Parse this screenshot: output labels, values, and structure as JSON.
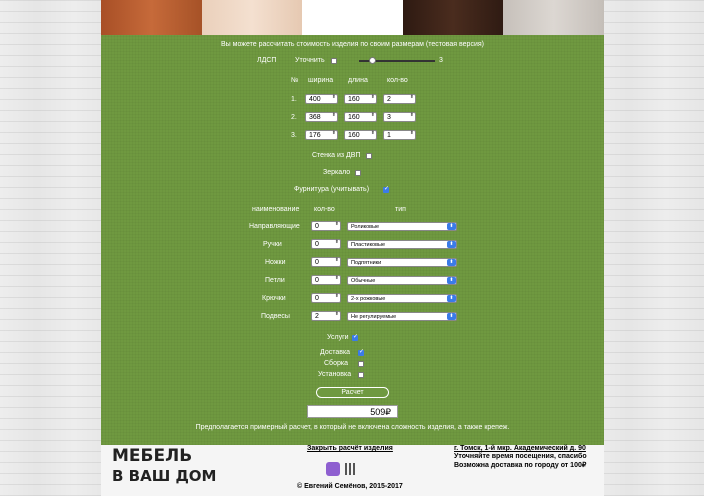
{
  "swatch_colors": [
    "#b85a2e",
    "#f0d8c4",
    "#ffffff",
    "#3b2218",
    "#cfc9c3"
  ],
  "header": {
    "title": "Вы можете рассчитать стоимость изделия по своим размерам (тестовая версия)"
  },
  "material": {
    "label": "ЛДСП",
    "refine_label": "Уточнить",
    "slider_value": "3"
  },
  "dims": {
    "col_no": "№",
    "col_width": "ширина",
    "col_length": "длина",
    "col_qty": "кол-во",
    "rows": [
      {
        "n": "1.",
        "width": "400",
        "length": "160",
        "qty": "2"
      },
      {
        "n": "2.",
        "width": "368",
        "length": "160",
        "qty": "3"
      },
      {
        "n": "3.",
        "width": "176",
        "length": "160",
        "qty": "1"
      }
    ]
  },
  "options": {
    "dvp_label": "Стенка из ДВП",
    "mirror_label": "Зеркало",
    "fittings_label": "Фурнитура (учитывать)"
  },
  "fittings": {
    "col_name": "наименование",
    "col_qty": "кол-во",
    "col_type": "тип",
    "rows": [
      {
        "name": "Направляющие",
        "qty": "0",
        "type": "Роликовые"
      },
      {
        "name": "Ручки",
        "qty": "0",
        "type": "Пластиковые"
      },
      {
        "name": "Ножки",
        "qty": "0",
        "type": "Подпятники"
      },
      {
        "name": "Петли",
        "qty": "0",
        "type": "Обычные"
      },
      {
        "name": "Крючки",
        "qty": "0",
        "type": "2-х рожковые"
      },
      {
        "name": "Подвесы",
        "qty": "2",
        "type": "Не регулируемые"
      }
    ]
  },
  "services": {
    "label": "Услуги",
    "delivery": "Доставка",
    "assembly": "Сборка",
    "install": "Установка"
  },
  "calc_button": "Расчет",
  "total": "509₽",
  "note": "Предполагается примерный расчет, в который не включена сложность изделия, а также крепеж.",
  "footer": {
    "logo_line1": "МЕБЕЛЬ",
    "logo_line2": "В ВАШ ДОМ",
    "close_link": "Закрыть расчёт изделия",
    "address": "г. Томск, 1-й мкр. Академический д. 90",
    "visit": "Уточняйте время посещения, спасибо",
    "delivery": "Возможна доставка по городу от 100₽",
    "copyright": "© Евгений Семёнов, 2015-2017"
  }
}
